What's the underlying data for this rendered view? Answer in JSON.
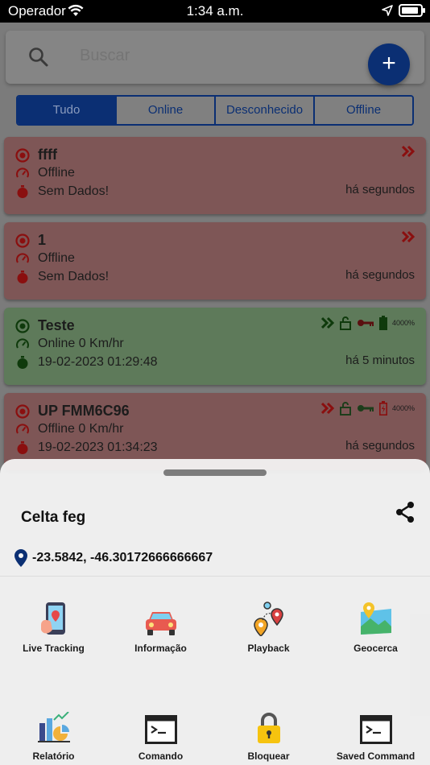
{
  "status_bar": {
    "carrier": "Operador",
    "time": "1:34 a.m."
  },
  "search": {
    "placeholder": "Buscar"
  },
  "add_button": {
    "label": "+"
  },
  "tabs": [
    {
      "label": "Tudo",
      "active": true
    },
    {
      "label": "Online",
      "active": false
    },
    {
      "label": "Desconhecido",
      "active": false
    },
    {
      "label": "Offline",
      "active": false
    }
  ],
  "devices": [
    {
      "name": "ffff",
      "status": "Offline",
      "info": "Sem Dados!",
      "ago": "há segundos",
      "color": "#d41b1b"
    },
    {
      "name": "1",
      "status": "Offline",
      "info": "Sem Dados!",
      "ago": "há segundos",
      "color": "#d41b1b"
    },
    {
      "name": "Teste",
      "status": "Online 0 Km/hr",
      "info": "19-02-2023 01:29:48",
      "ago": "há 5 minutos",
      "color": "#1d6b17",
      "battery": "4000%"
    },
    {
      "name": "UP FMM6C96",
      "status": "Offline 0 Km/hr",
      "info": "19-02-2023 01:34:23",
      "ago": "há segundos",
      "color": "#d41b1b",
      "battery": "4000%"
    }
  ],
  "sheet": {
    "title": "Celta feg",
    "coordinates": "-23.5842, -46.30172666666667",
    "actions": [
      {
        "label": "Live Tracking",
        "icon": "live-tracking-icon"
      },
      {
        "label": "Informação",
        "icon": "car-icon"
      },
      {
        "label": "Playback",
        "icon": "playback-pins-icon"
      },
      {
        "label": "Geocerca",
        "icon": "geofence-map-icon"
      },
      {
        "label": "Relatório",
        "icon": "report-chart-icon"
      },
      {
        "label": "Comando",
        "icon": "terminal-icon"
      },
      {
        "label": "Bloquear",
        "icon": "lock-icon"
      },
      {
        "label": "Saved Command",
        "icon": "saved-command-terminal-icon"
      }
    ]
  },
  "colors": {
    "primary": "#0b2f73",
    "offline": "#d41b1b",
    "online": "#1d6b17"
  }
}
